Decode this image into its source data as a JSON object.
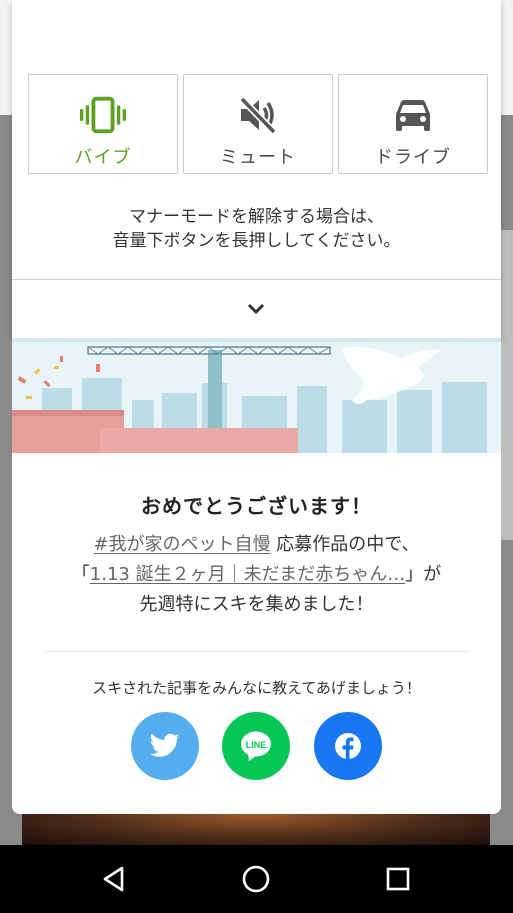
{
  "volume_panel": {
    "modes": [
      {
        "label": "バイブ",
        "icon": "vibrate-icon",
        "active": true
      },
      {
        "label": "ミュート",
        "icon": "volume-off-icon",
        "active": false
      },
      {
        "label": "ドライブ",
        "icon": "car-icon",
        "active": false
      }
    ],
    "manner_text_line1": "マナーモードを解除する場合は、",
    "manner_text_line2": "音量下ボタンを長押ししてください。",
    "expand_icon": "chevron-down-icon",
    "accent_color": "#5da121"
  },
  "dialog": {
    "title": "おめでとうございます！",
    "hashtag_link": "#我が家のペット自慢",
    "line1_suffix": "応募作品の中で、",
    "quote_open": "「",
    "article_link": "1.13 誕生２ヶ月｜未だまだ赤ちゃん…",
    "quote_close": "」が",
    "line3": "先週特にスキを集めました！",
    "share_prompt": "スキされた記事をみんなに教えてあげましょう！",
    "share_buttons": [
      {
        "name": "twitter",
        "icon": "twitter-icon",
        "color": "#55acee"
      },
      {
        "name": "line",
        "icon": "line-icon",
        "label": "LINE",
        "color": "#06c755"
      },
      {
        "name": "facebook",
        "icon": "facebook-icon",
        "color": "#1877f2"
      }
    ]
  },
  "nav_bar": {
    "buttons": [
      "back-icon",
      "home-icon",
      "recent-apps-icon"
    ]
  }
}
